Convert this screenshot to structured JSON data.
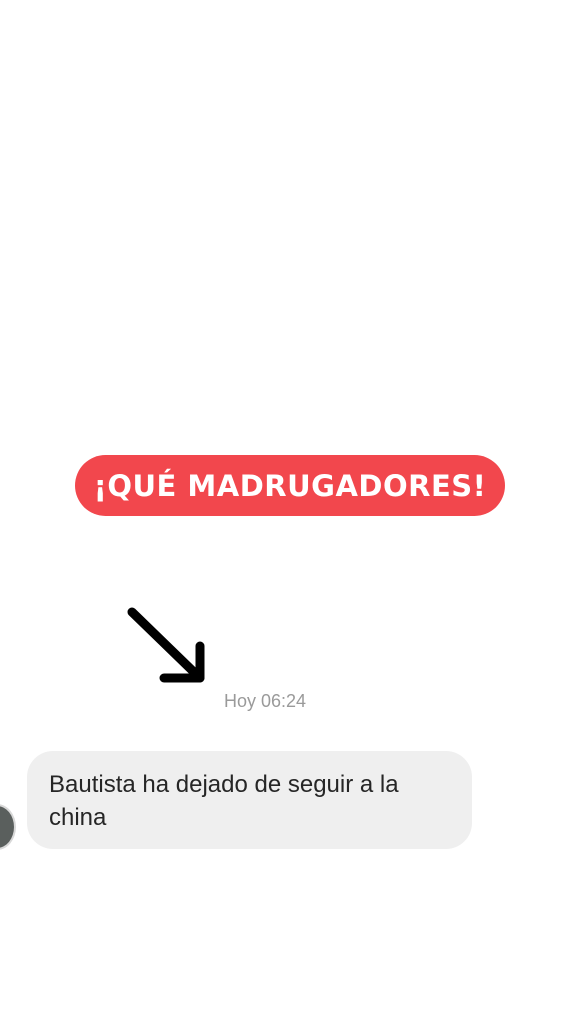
{
  "banner": {
    "text": "¡QUÉ MADRUGADORES!",
    "color": "#f2474d"
  },
  "annotation": {
    "icon": "arrow-down-right-icon"
  },
  "chat": {
    "timestamp": "Hoy 06:24",
    "message": {
      "text": "Bautista ha dejado de seguir a la china"
    },
    "avatar_icon": "avatar"
  }
}
